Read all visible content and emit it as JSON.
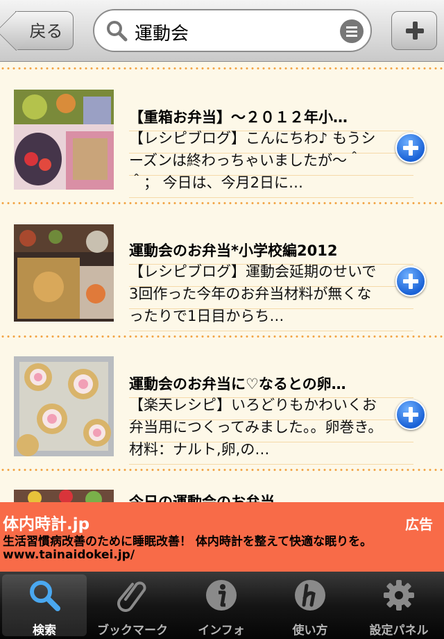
{
  "navbar": {
    "back_label": "戻る",
    "search_value": "運動会"
  },
  "results": [
    {
      "title": "【重箱お弁当】〜２０１２年小…",
      "description": "【レシピブログ】こんにちわ♪ もうシーズンは終わっちゃいましたが〜＾＾； 今日は、今月2日に…"
    },
    {
      "title": "運動会のお弁当*小学校編2012",
      "description": "【レシピブログ】運動会延期のせいで3回作った今年のお弁当材料が無くなったりで1日目からち…"
    },
    {
      "title": "運動会のお弁当に♡なるとの卵…",
      "description": "【楽天レシピ】いろどりもかわいくお弁当用につくってみました。。卵巻き。材料：ナルト,卵,の…"
    },
    {
      "title": "今日の運動会のお弁当"
    }
  ],
  "ad": {
    "title": "体内時計.jp",
    "label": "広告",
    "text": "生活習慣病改善のために睡眠改善！ 体内時計を整えて快適な眠りを。",
    "url": "www.tainaidokei.jp/"
  },
  "tabs": [
    {
      "label": "検索",
      "icon": "search-icon",
      "active": true
    },
    {
      "label": "ブックマーク",
      "icon": "paperclip-icon"
    },
    {
      "label": "インフォ",
      "icon": "info-icon"
    },
    {
      "label": "使い方",
      "icon": "help-icon"
    },
    {
      "label": "設定パネル",
      "icon": "gear-icon"
    }
  ],
  "colors": {
    "accent": "#1a62d6",
    "ad_background": "#f86b48",
    "divider": "#f2a547",
    "list_background": "#fdf8e8"
  }
}
